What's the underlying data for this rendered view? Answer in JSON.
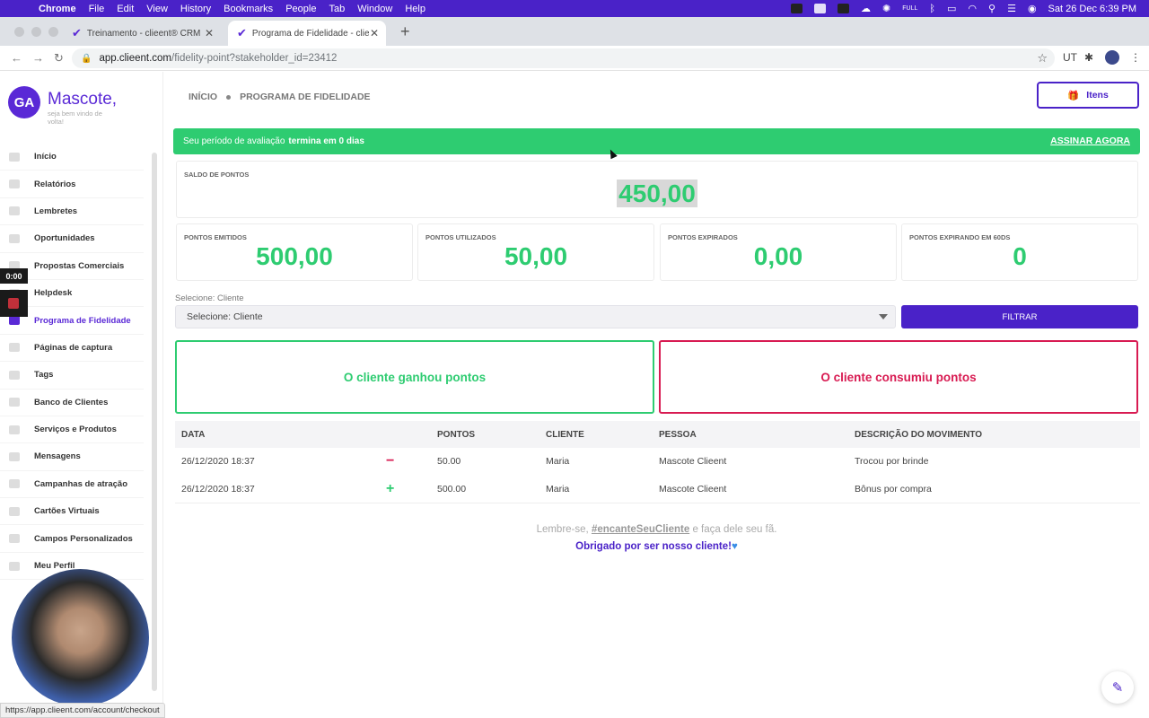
{
  "menubar": {
    "app": "Chrome",
    "items": [
      "File",
      "Edit",
      "View",
      "History",
      "Bookmarks",
      "People",
      "Tab",
      "Window",
      "Help"
    ],
    "battery_label": "FULL",
    "clock": "Sat 26 Dec  6:39 PM"
  },
  "tabs": [
    {
      "title": "Treinamento - clieent® CRM"
    },
    {
      "title": "Programa de Fidelidade - clieent"
    }
  ],
  "address": {
    "domain": "app.clieent.com",
    "path": "/fidelity-point?stakeholder_id=23412"
  },
  "sidebar": {
    "avatar_initials": "GA",
    "user_name": "Mascote,",
    "welcome": "seja bem vindo de volta!",
    "items": [
      {
        "label": "Início",
        "active": false
      },
      {
        "label": "Relatórios",
        "active": false
      },
      {
        "label": "Lembretes",
        "active": false
      },
      {
        "label": "Oportunidades",
        "active": false
      },
      {
        "label": "Propostas Comerciais",
        "active": false
      },
      {
        "label": "Helpdesk",
        "active": false
      },
      {
        "label": "Programa de Fidelidade",
        "active": true
      },
      {
        "label": "Páginas de captura",
        "active": false
      },
      {
        "label": "Tags",
        "active": false
      },
      {
        "label": "Banco de Clientes",
        "active": false
      },
      {
        "label": "Serviços e Produtos",
        "active": false
      },
      {
        "label": "Mensagens",
        "active": false
      },
      {
        "label": "Campanhas de atração",
        "active": false
      },
      {
        "label": "Cartões Virtuais",
        "active": false
      },
      {
        "label": "Campos Personalizados",
        "active": false
      },
      {
        "label": "Meu Perfil",
        "active": false
      }
    ]
  },
  "recorder": {
    "timer": "0:00"
  },
  "breadcrumb": {
    "home": "INÍCIO",
    "current": "PROGRAMA DE FIDELIDADE"
  },
  "itens_button": "Itens",
  "trial": {
    "text": "Seu período de avaliação",
    "bold": "termina em 0 dias",
    "cta": "ASSINAR AGORA"
  },
  "balance": {
    "label": "SALDO DE PONTOS",
    "value": "450,00"
  },
  "stats": [
    {
      "label": "PONTOS EMITIDOS",
      "value": "500,00"
    },
    {
      "label": "PONTOS UTILIZADOS",
      "value": "50,00"
    },
    {
      "label": "PONTOS EXPIRADOS",
      "value": "0,00"
    },
    {
      "label": "PONTOS EXPIRANDO EM 60DS",
      "value": "0"
    }
  ],
  "filter": {
    "label": "Selecione: Cliente",
    "selected": "Selecione: Cliente",
    "button": "FILTRAR"
  },
  "legend": {
    "earned": "O cliente ganhou pontos",
    "consumed": "O cliente consumiu pontos"
  },
  "table": {
    "headers": {
      "data": "DATA",
      "pontos": "PONTOS",
      "cliente": "CLIENTE",
      "pessoa": "PESSOA",
      "descricao": "DESCRIÇÃO DO MOVIMENTO"
    },
    "rows": [
      {
        "data": "26/12/2020 18:37",
        "sign": "−",
        "pontos": "50.00",
        "cliente": "Maria",
        "pessoa": "Mascote Clieent",
        "descricao": "Trocou por brinde"
      },
      {
        "data": "26/12/2020 18:37",
        "sign": "+",
        "pontos": "500.00",
        "cliente": "Maria",
        "pessoa": "Mascote Clieent",
        "descricao": "Bônus por compra"
      }
    ]
  },
  "footer": {
    "line1_pre": "Lembre-se,",
    "hashtag": "#encanteSeuCliente",
    "line1_post": "e faça dele seu fã.",
    "line2": "Obrigado por ser nosso cliente!"
  },
  "status_url": "https://app.clieent.com/account/checkout",
  "colors": {
    "brand": "#4a22c8",
    "positive": "#2ecc71",
    "negative": "#d81b52"
  }
}
